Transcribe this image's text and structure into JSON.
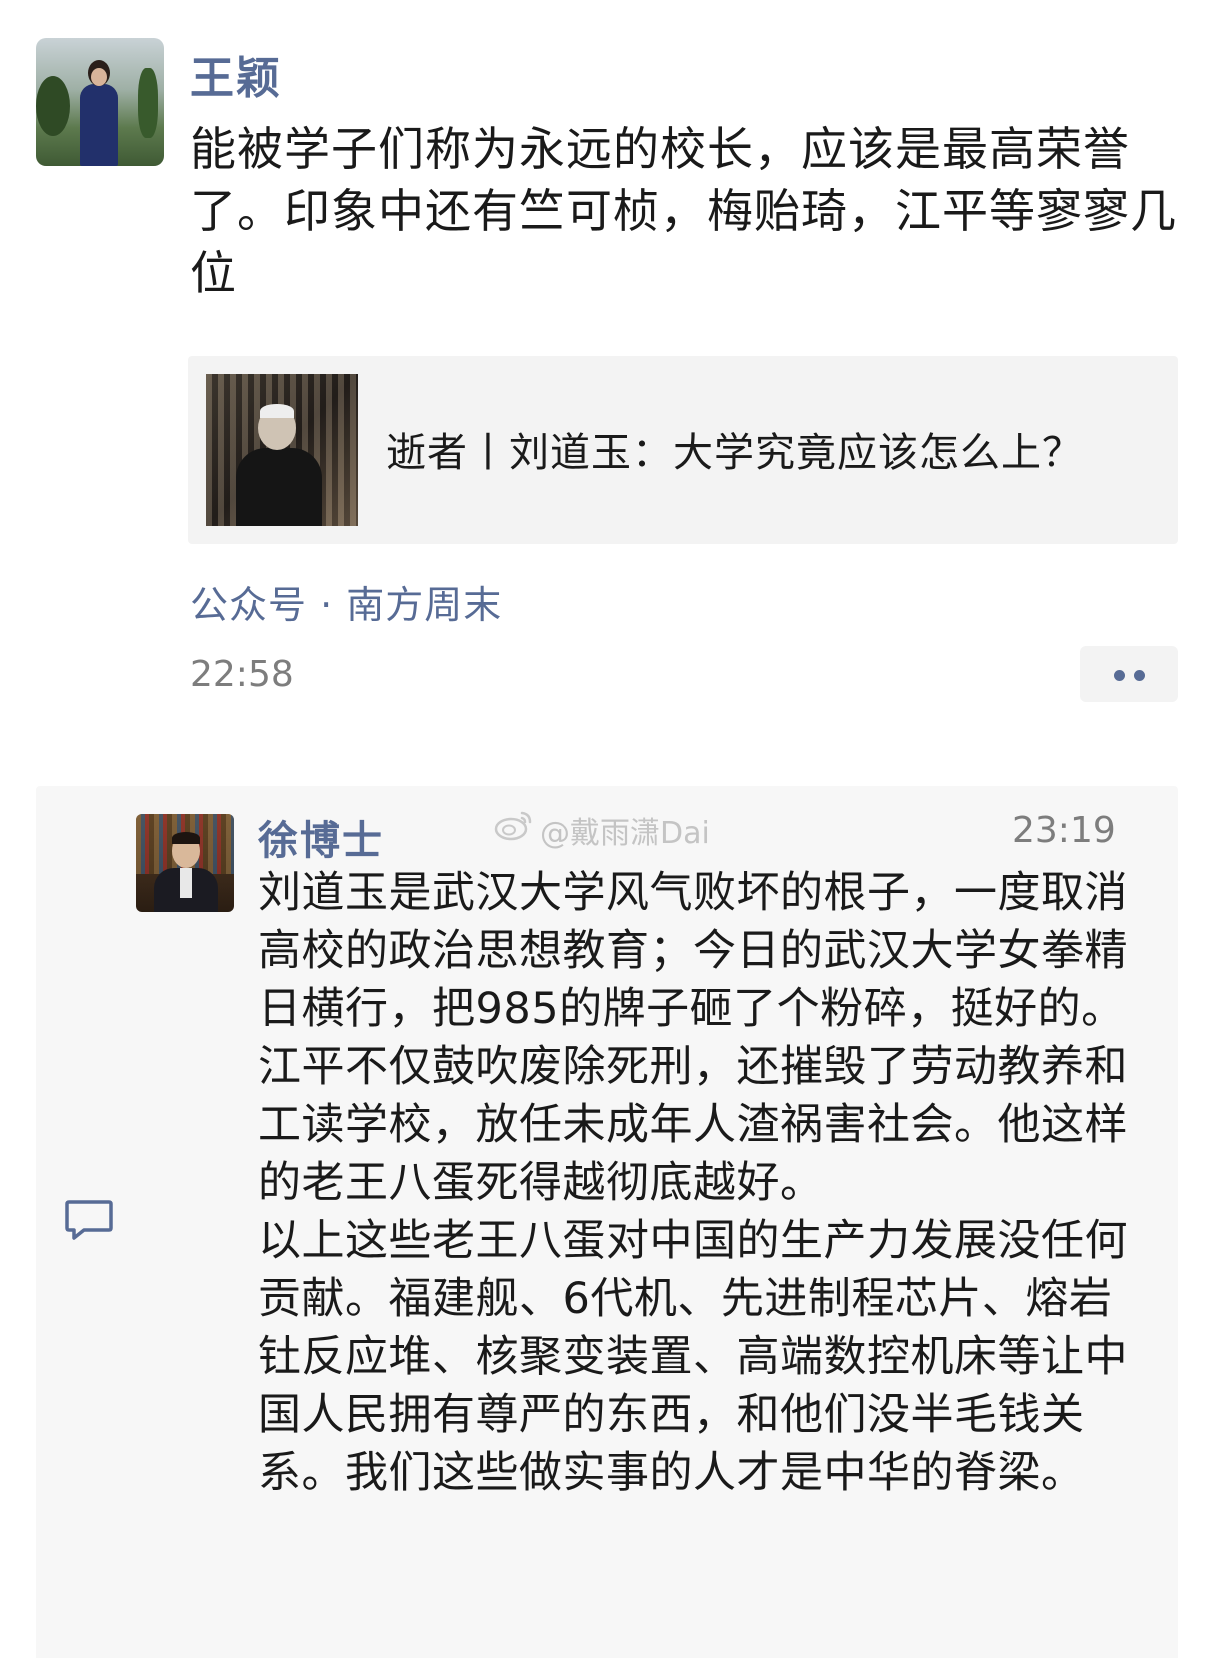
{
  "post": {
    "author": "王颖",
    "text": "能被学子们称为永远的校长，应该是最高荣誉了。印象中还有竺可桢，梅贻琦，江平等寥寥几位",
    "link_title": "逝者丨刘道玉：大学究竟应该怎么上？",
    "source": "公众号 · 南方周末",
    "time": "22:58"
  },
  "comment": {
    "author": "徐博士",
    "time": "23:19",
    "watermark": "@戴雨潇Dai",
    "paragraphs": [
      "刘道玉是武汉大学风气败坏的根子，一度取消高校的政治思想教育；今日的武汉大学女拳精日横行，把985的牌子砸了个粉碎，挺好的。",
      "江平不仅鼓吹废除死刑，还摧毁了劳动教养和工读学校，放任未成年人渣祸害社会。他这样的老王八蛋死得越彻底越好。",
      "以上这些老王八蛋对中国的生产力发展没任何贡献。福建舰、6代机、先进制程芯片、熔岩钍反应堆、核聚变装置、高端数控机床等让中国人民拥有尊严的东西，和他们没半毛钱关系。我们这些做实事的人才是中华的脊梁。"
    ]
  },
  "colors": {
    "name_link": "#576b95",
    "time_gray": "#7d7d7d",
    "card_bg": "#f3f3f3",
    "comment_bg": "#f7f7f7"
  },
  "icons": {
    "more": "more-dots-icon",
    "comment": "comment-bubble-icon",
    "weibo": "weibo-logo-icon"
  }
}
